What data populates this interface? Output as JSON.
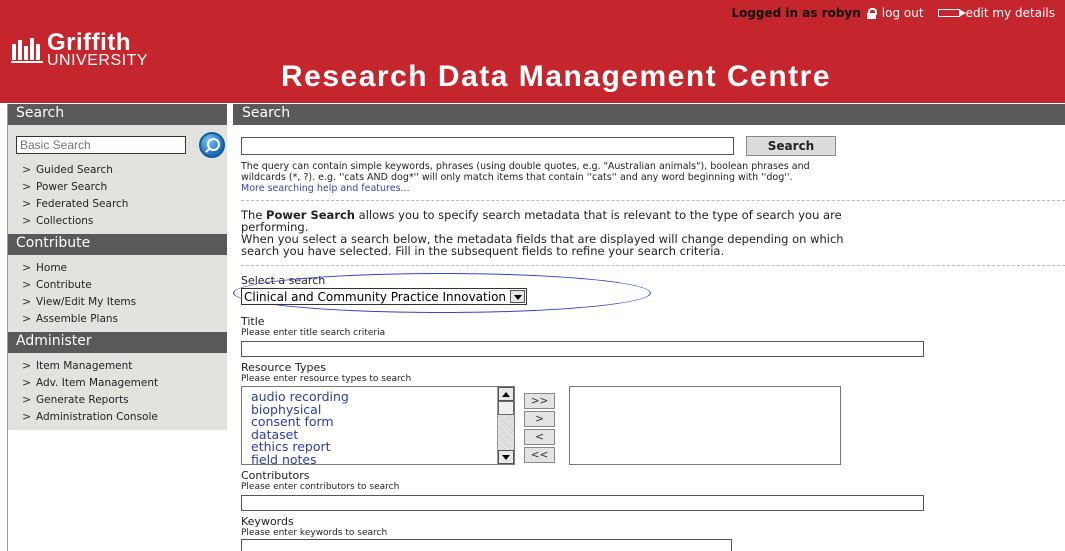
{
  "header": {
    "logged_in_text": "Logged in as robyn",
    "logout_label": "log out",
    "edit_details_label": "edit my details",
    "logo_line1": "Griffith",
    "logo_line2": "UNIVERSITY",
    "site_title": "Research Data Management Centre",
    "accent_color": "#c5262d"
  },
  "sidebar": {
    "search_heading": "Search",
    "basic_search_placeholder": "Basic Search",
    "search_items": [
      {
        "label": "Guided Search"
      },
      {
        "label": "Power Search"
      },
      {
        "label": "Federated Search"
      },
      {
        "label": "Collections"
      }
    ],
    "contribute_heading": "Contribute",
    "contribute_items": [
      {
        "label": "Home"
      },
      {
        "label": "Contribute"
      },
      {
        "label": "View/Edit My Items"
      },
      {
        "label": "Assemble Plans"
      }
    ],
    "administer_heading": "Administer",
    "administer_items": [
      {
        "label": "Item Management"
      },
      {
        "label": "Adv. Item Management"
      },
      {
        "label": "Generate Reports"
      },
      {
        "label": "Administration Console"
      }
    ]
  },
  "main": {
    "heading": "Search",
    "search_button": "Search",
    "help_line1": "The query can contain simple keywords, phrases (using double quotes, e.g. \"Australian animals\"), boolean phrases and",
    "help_line2": "wildcards (*, ?). e.g. ''cats AND dog*'' will only match items that contain ''cats'' and any word beginning with ''dog''.",
    "help_link": "More searching help and features...",
    "intro_pre": "The ",
    "intro_bold": "Power Search",
    "intro_post": " allows you to specify search metadata that is relevant to the type of search you are",
    "intro_line2": "performing.",
    "intro_line3": "When you select a search below, the metadata fields that are displayed will change depending on which",
    "intro_line4": "search you have selected. Fill in the subsequent fields to refine your search criteria.",
    "select_label": "Select a search",
    "select_value": "Clinical and Community Practice Innovation",
    "title_label": "Title",
    "title_hint": "Please enter title search criteria",
    "resource_label": "Resource Types",
    "resource_hint": "Please enter resource types to search",
    "resource_options": [
      "audio recording",
      "biophysical",
      "consent form",
      "dataset",
      "ethics report",
      "field notes"
    ],
    "move_buttons": [
      ">>",
      ">",
      "<",
      "<<"
    ],
    "contributors_label": "Contributors",
    "contributors_hint": "Please enter contributors to search",
    "keywords_label": "Keywords",
    "keywords_hint": "Please enter keywords to search"
  }
}
